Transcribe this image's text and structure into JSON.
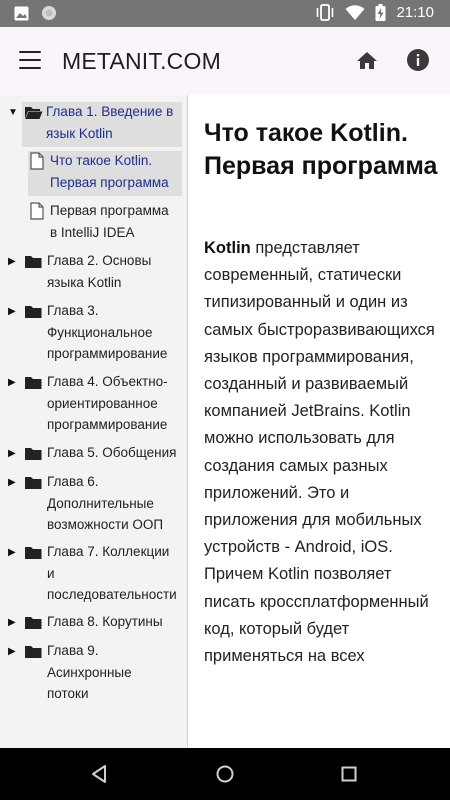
{
  "status_bar": {
    "time": "21:10",
    "left_icons": [
      "image-icon",
      "circle-icon"
    ],
    "right_icons": [
      "vibrate-icon",
      "wifi-icon",
      "battery-charging-icon"
    ]
  },
  "app_bar": {
    "title": "METANIT.COM",
    "menu_icon": "hamburger-menu-icon",
    "home_icon": "home-icon",
    "info_icon": "info-icon"
  },
  "sidebar": {
    "items": [
      {
        "lines": [
          "Глава 1. Введение в",
          "язык Kotlin"
        ],
        "type": "folder-open",
        "expanded": true,
        "active": true
      },
      {
        "lines": [
          "Что такое Kotlin.",
          "Первая программа"
        ],
        "type": "page",
        "active": true
      },
      {
        "lines": [
          "Первая программа",
          "в IntelliJ IDEA"
        ],
        "type": "page",
        "active": false
      },
      {
        "lines": [
          "Глава 2. Основы",
          "языка Kotlin"
        ],
        "type": "folder",
        "expanded": false
      },
      {
        "lines": [
          "Глава 3.",
          "Функциональное",
          "программирование"
        ],
        "type": "folder",
        "expanded": false
      },
      {
        "lines": [
          "Глава 4. Объектно-",
          "ориентированное",
          "программирование"
        ],
        "type": "folder",
        "expanded": false
      },
      {
        "lines": [
          "Глава 5. Обобщения"
        ],
        "type": "folder",
        "expanded": false
      },
      {
        "lines": [
          "Глава 6.",
          "Дополнительные",
          "возможности ООП"
        ],
        "type": "folder",
        "expanded": false
      },
      {
        "lines": [
          "Глава 7. Коллекции",
          "и",
          "последовательности"
        ],
        "type": "folder",
        "expanded": false
      },
      {
        "lines": [
          "Глава 8. Корутины"
        ],
        "type": "folder",
        "expanded": false
      },
      {
        "lines": [
          "Глава 9.",
          "Асинхронные",
          "потоки"
        ],
        "type": "folder",
        "expanded": false
      }
    ]
  },
  "article": {
    "title": "Что такое Kotlin. Первая программа",
    "bold_lead": "Kotlin",
    "body": " представляет современный, статически типизированный и один из самых быстроразвивающихся языков программирования, созданный и развиваемый компанией JetBrains. Kotlin можно использовать для создания самых разных приложений. Это и приложения для мобильных устройств - Android, iOS. Причем Kotlin позволяет писать кроссплатформенный код, который будет применяться на всех"
  },
  "nav_bar": {
    "buttons": [
      "back-icon",
      "home-circle-icon",
      "recents-icon"
    ]
  },
  "colors": {
    "status_bar": "#757575",
    "app_bar": "#fbf4fb",
    "sidebar_bg": "#f3f3f3",
    "highlight": "#dedede",
    "active_link": "#1d2f8f",
    "nav_bar": "#000000"
  }
}
